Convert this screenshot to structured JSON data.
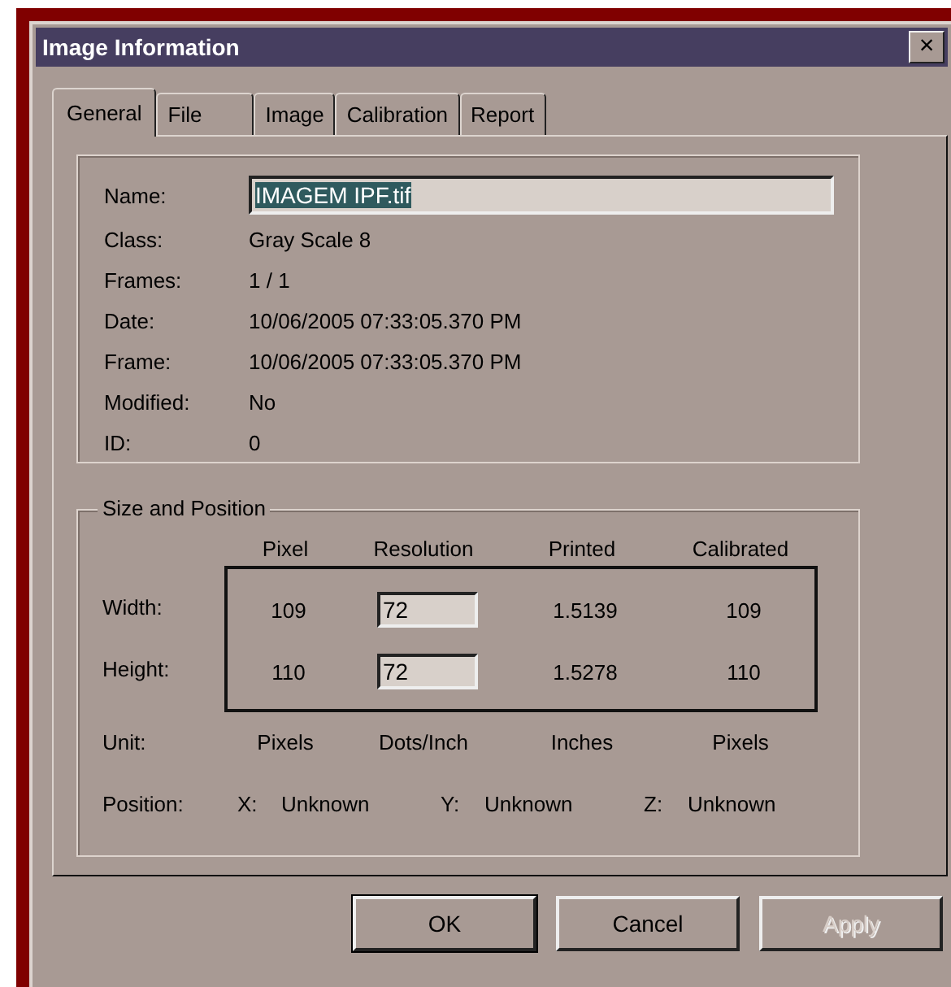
{
  "window": {
    "title": "Image Information",
    "close": "×"
  },
  "tabs": [
    {
      "label": "General",
      "selected": true
    },
    {
      "label": "File",
      "selected": false
    },
    {
      "label": "Image",
      "selected": false
    },
    {
      "label": "Calibration",
      "selected": false
    },
    {
      "label": "Report",
      "selected": false
    }
  ],
  "general": {
    "name": {
      "label": "Name:",
      "value": "IMAGEM IPF.tif",
      "highlighted": true
    },
    "fields": [
      {
        "label": "Class:",
        "value": "Gray Scale 8"
      },
      {
        "label": "Frames:",
        "value": "1 / 1"
      },
      {
        "label": "Date:",
        "value": "10/06/2005 07:33:05.370 PM"
      },
      {
        "label": "Frame:",
        "value": "10/06/2005 07:33:05.370 PM"
      },
      {
        "label": "Modified:",
        "value": "No"
      },
      {
        "label": "ID:",
        "value": "0"
      }
    ]
  },
  "size_position": {
    "title": "Size and Position",
    "columns": [
      "Pixel",
      "Resolution",
      "Printed",
      "Calibrated"
    ],
    "rows": [
      {
        "label": "Width:",
        "pixel": "109",
        "resolution": "72",
        "printed": "1.5139",
        "calibrated": "109"
      },
      {
        "label": "Height:",
        "pixel": "110",
        "resolution": "72",
        "printed": "1.5278",
        "calibrated": "110"
      }
    ],
    "unit": {
      "label": "Unit:",
      "values": [
        "Pixels",
        "Dots/Inch",
        "Inches",
        "Pixels"
      ]
    },
    "position": {
      "label": "Position:",
      "axes": [
        {
          "axis": "X:",
          "value": "Unknown"
        },
        {
          "axis": "Y:",
          "value": "Unknown"
        },
        {
          "axis": "Z:",
          "value": "Unknown"
        }
      ]
    }
  },
  "buttons": [
    {
      "label": "OK",
      "disabled": false,
      "default": true
    },
    {
      "label": "Cancel",
      "disabled": false,
      "default": false
    },
    {
      "label": "Apply",
      "disabled": true,
      "default": false
    }
  ]
}
